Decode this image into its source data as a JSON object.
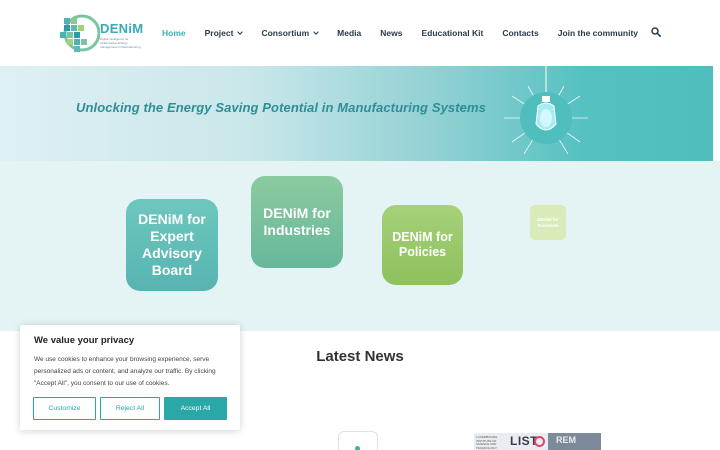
{
  "header": {
    "logo_text": "DENiM",
    "logo_tagline": "Digital intelligence for collaborative ENergy management in Manufacturing",
    "nav": [
      {
        "label": "Home",
        "active": true,
        "has_dropdown": false
      },
      {
        "label": "Project",
        "active": false,
        "has_dropdown": true
      },
      {
        "label": "Consortium",
        "active": false,
        "has_dropdown": true
      },
      {
        "label": "Media",
        "active": false,
        "has_dropdown": false
      },
      {
        "label": "News",
        "active": false,
        "has_dropdown": false
      },
      {
        "label": "Educational Kit",
        "active": false,
        "has_dropdown": false
      },
      {
        "label": "Contacts",
        "active": false,
        "has_dropdown": false
      },
      {
        "label": "Join the community",
        "active": false,
        "has_dropdown": false
      }
    ],
    "search_icon": "search-icon"
  },
  "hero": {
    "tagline": "Unlocking the Energy Saving Potential in Manufacturing Systems",
    "illustration": "lightbulb-icon"
  },
  "tiles": {
    "expert": "DENiM for Expert Advisory Board",
    "industries": "DENiM for Industries",
    "policies": "DENiM for Policies",
    "scientists": "DENiM for Scientists"
  },
  "latest_news": {
    "title": "Latest News",
    "image_text": {
      "list": "LIST",
      "institute": "LUXEMBOURG INSTITUTE OF SCIENCE AND TECHNOLOGY",
      "rem": "REM"
    }
  },
  "cookie_banner": {
    "title": "We value your privacy",
    "text": "We use cookies to enhance your browsing experience, serve personalized ads or content, and analyze our traffic. By clicking \"Accept All\", you consent to our use of cookies.",
    "customize_label": "Customize",
    "reject_label": "Reject All",
    "accept_label": "Accept All"
  },
  "colors": {
    "accent": "#3ab3b3",
    "tile_expert": "#5fbab5",
    "tile_industries": "#7bc29d",
    "tile_policies": "#9ac96a",
    "tile_scientists": "#d8ebb8"
  }
}
